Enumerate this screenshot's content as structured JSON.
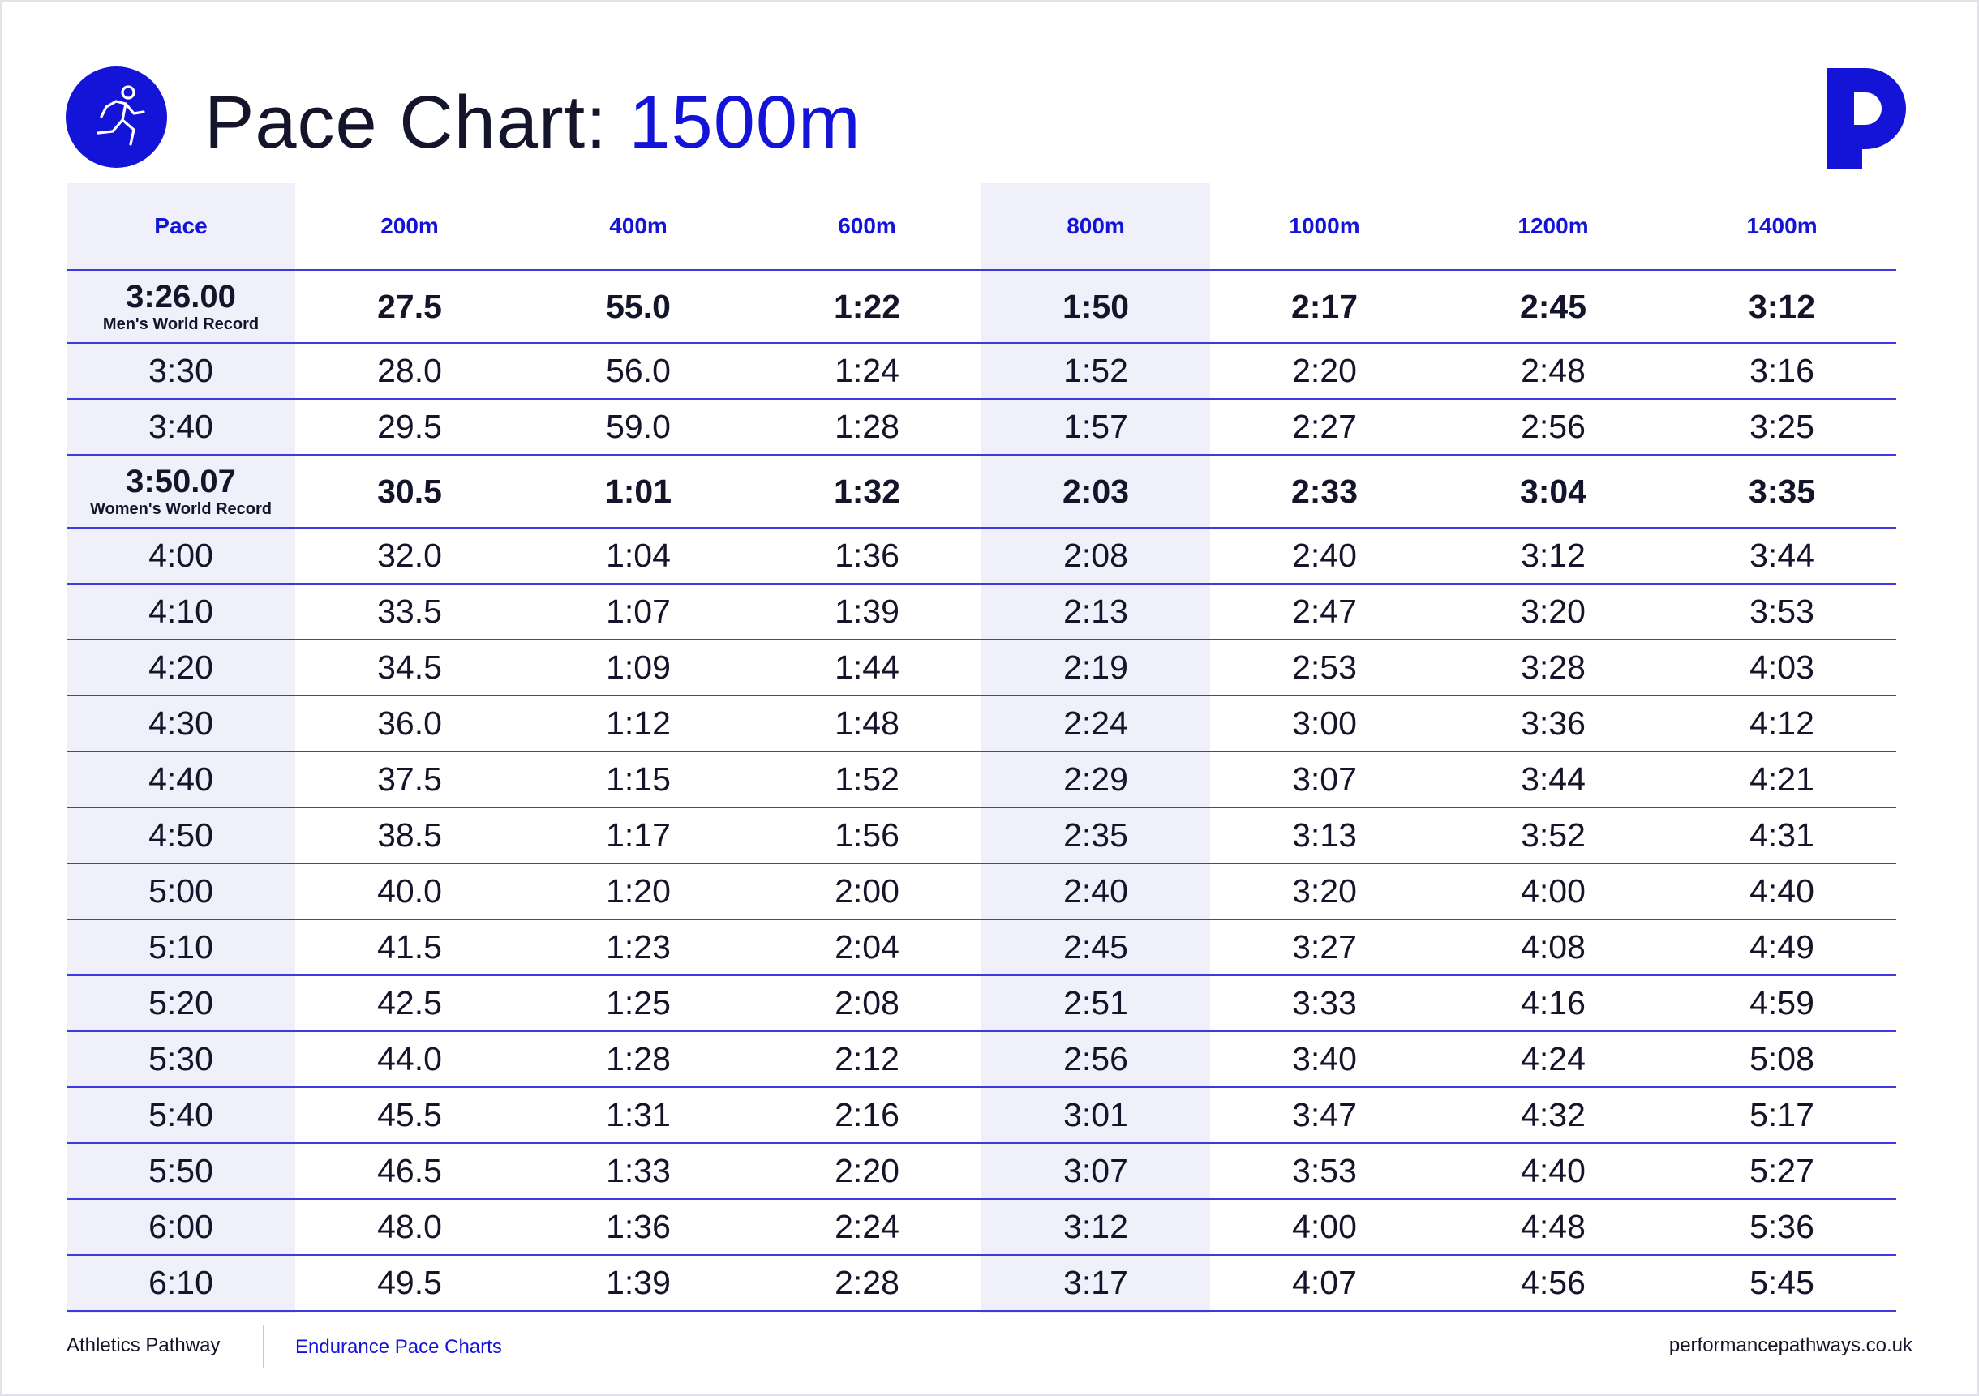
{
  "colors": {
    "accent": "#1414d9",
    "text": "#14142b",
    "shade": "#f0f0fb",
    "rule": "#3b3be0"
  },
  "header": {
    "title_main": "Pace Chart:",
    "title_accent": "1500m",
    "icon": "runner-icon",
    "brand_icon": "performance-pathways-p-logo"
  },
  "table": {
    "columns": [
      "Pace",
      "200m",
      "400m",
      "600m",
      "800m",
      "1000m",
      "1200m",
      "1400m"
    ],
    "shaded_columns": [
      "Pace",
      "800m"
    ],
    "rows": [
      {
        "pace": "3:26.00",
        "note": "Men's World Record",
        "record": true,
        "splits": [
          "27.5",
          "55.0",
          "1:22",
          "1:50",
          "2:17",
          "2:45",
          "3:12"
        ]
      },
      {
        "pace": "3:30",
        "splits": [
          "28.0",
          "56.0",
          "1:24",
          "1:52",
          "2:20",
          "2:48",
          "3:16"
        ]
      },
      {
        "pace": "3:40",
        "splits": [
          "29.5",
          "59.0",
          "1:28",
          "1:57",
          "2:27",
          "2:56",
          "3:25"
        ]
      },
      {
        "pace": "3:50.07",
        "note": "Women's World Record",
        "record": true,
        "splits": [
          "30.5",
          "1:01",
          "1:32",
          "2:03",
          "2:33",
          "3:04",
          "3:35"
        ]
      },
      {
        "pace": "4:00",
        "splits": [
          "32.0",
          "1:04",
          "1:36",
          "2:08",
          "2:40",
          "3:12",
          "3:44"
        ]
      },
      {
        "pace": "4:10",
        "splits": [
          "33.5",
          "1:07",
          "1:39",
          "2:13",
          "2:47",
          "3:20",
          "3:53"
        ]
      },
      {
        "pace": "4:20",
        "splits": [
          "34.5",
          "1:09",
          "1:44",
          "2:19",
          "2:53",
          "3:28",
          "4:03"
        ]
      },
      {
        "pace": "4:30",
        "splits": [
          "36.0",
          "1:12",
          "1:48",
          "2:24",
          "3:00",
          "3:36",
          "4:12"
        ]
      },
      {
        "pace": "4:40",
        "splits": [
          "37.5",
          "1:15",
          "1:52",
          "2:29",
          "3:07",
          "3:44",
          "4:21"
        ]
      },
      {
        "pace": "4:50",
        "splits": [
          "38.5",
          "1:17",
          "1:56",
          "2:35",
          "3:13",
          "3:52",
          "4:31"
        ]
      },
      {
        "pace": "5:00",
        "splits": [
          "40.0",
          "1:20",
          "2:00",
          "2:40",
          "3:20",
          "4:00",
          "4:40"
        ]
      },
      {
        "pace": "5:10",
        "splits": [
          "41.5",
          "1:23",
          "2:04",
          "2:45",
          "3:27",
          "4:08",
          "4:49"
        ]
      },
      {
        "pace": "5:20",
        "splits": [
          "42.5",
          "1:25",
          "2:08",
          "2:51",
          "3:33",
          "4:16",
          "4:59"
        ]
      },
      {
        "pace": "5:30",
        "splits": [
          "44.0",
          "1:28",
          "2:12",
          "2:56",
          "3:40",
          "4:24",
          "5:08"
        ]
      },
      {
        "pace": "5:40",
        "splits": [
          "45.5",
          "1:31",
          "2:16",
          "3:01",
          "3:47",
          "4:32",
          "5:17"
        ]
      },
      {
        "pace": "5:50",
        "splits": [
          "46.5",
          "1:33",
          "2:20",
          "3:07",
          "3:53",
          "4:40",
          "5:27"
        ]
      },
      {
        "pace": "6:00",
        "splits": [
          "48.0",
          "1:36",
          "2:24",
          "3:12",
          "4:00",
          "4:48",
          "5:36"
        ]
      },
      {
        "pace": "6:10",
        "splits": [
          "49.5",
          "1:39",
          "2:28",
          "3:17",
          "4:07",
          "4:56",
          "5:45"
        ]
      }
    ]
  },
  "footer": {
    "left": "Athletics Pathway",
    "middle": "Endurance Pace Charts",
    "right": "performancepathways.co.uk"
  }
}
